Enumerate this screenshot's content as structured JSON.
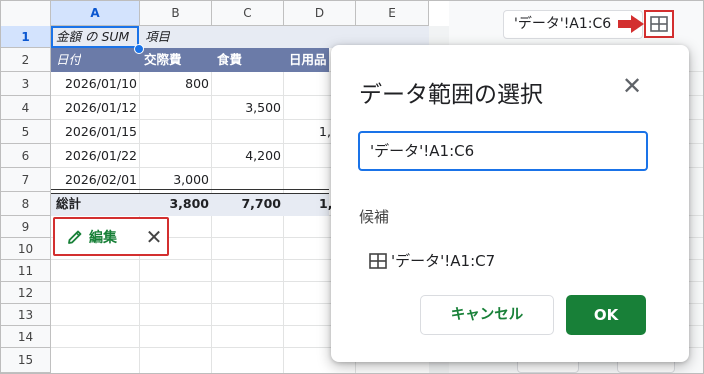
{
  "columns": [
    "A",
    "B",
    "C",
    "D",
    "E"
  ],
  "rows": [
    "1",
    "2",
    "3",
    "4",
    "5",
    "6",
    "7",
    "8",
    "9",
    "10",
    "11",
    "12",
    "13",
    "14",
    "15"
  ],
  "pivot": {
    "a1": "金額 の SUM",
    "b1": "項目",
    "header": [
      "日付",
      "交際費",
      "食費",
      "日用品"
    ],
    "data": [
      {
        "date": "2026/01/10",
        "b": "800",
        "c": "",
        "d": ""
      },
      {
        "date": "2026/01/12",
        "b": "",
        "c": "3,500",
        "d": ""
      },
      {
        "date": "2026/01/15",
        "b": "",
        "c": "",
        "d": "1,"
      },
      {
        "date": "2026/01/22",
        "b": "",
        "c": "4,200",
        "d": ""
      },
      {
        "date": "2026/02/01",
        "b": "3,000",
        "c": "",
        "d": ""
      }
    ],
    "total": {
      "label": "総計",
      "b": "3,800",
      "c": "7,700",
      "d": "1,"
    }
  },
  "edit_chip": {
    "label": "編集",
    "close": "✕"
  },
  "range_field": {
    "value": "'データ'!A1:C6"
  },
  "dialog": {
    "title": "データ範囲の選択",
    "close": "✕",
    "input_value": "'データ'!A1:C6",
    "candidates_label": "候補",
    "candidate": "'データ'!A1:C7",
    "cancel_label": "キャンセル",
    "ok_label": "OK"
  },
  "colors": {
    "accent": "#1a73e8",
    "green": "#188038",
    "highlight_red": "#d32f2f",
    "pivot_header": "#6b7ba8"
  }
}
